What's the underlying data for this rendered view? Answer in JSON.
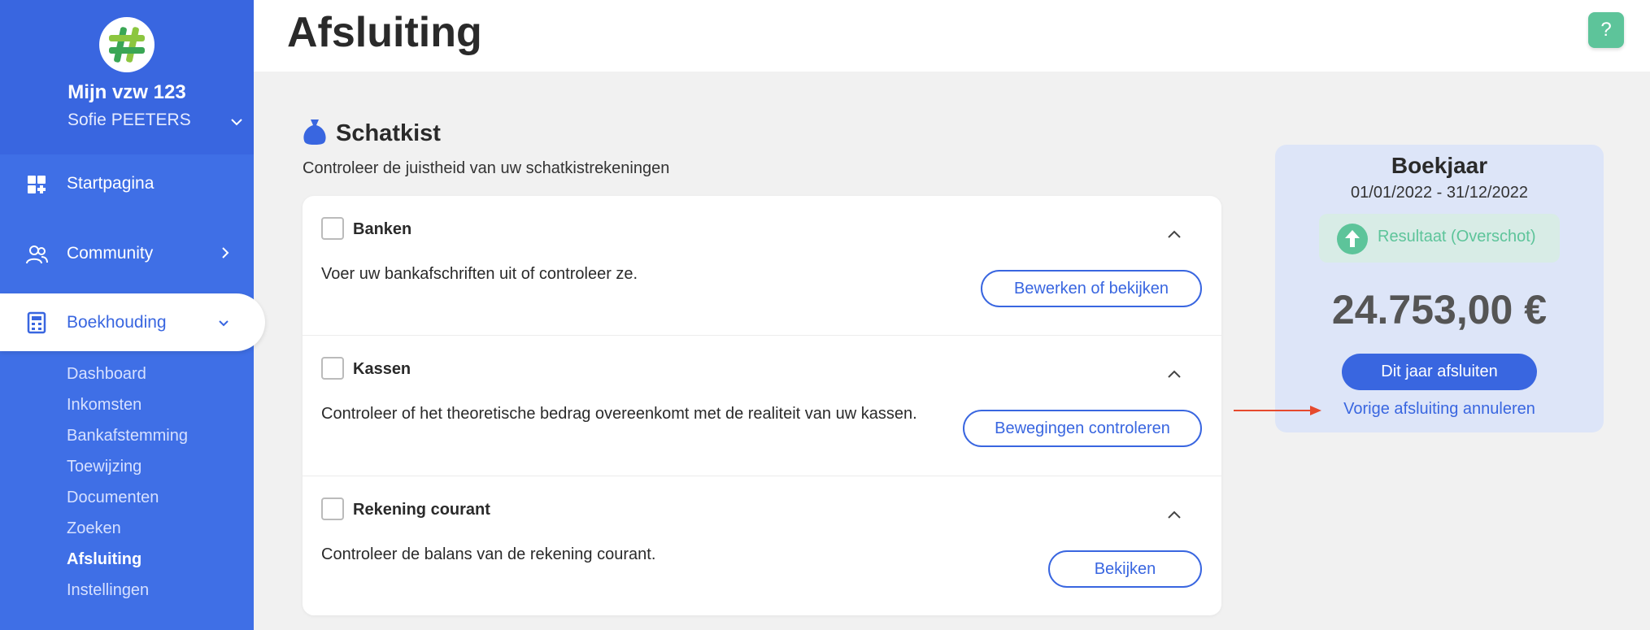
{
  "sidebar": {
    "org_name": "Mijn vzw 123",
    "user_name": "Sofie PEETERS",
    "nav": {
      "home": "Startpagina",
      "community": "Community",
      "accounting": "Boekhouding"
    },
    "subnav": [
      "Dashboard",
      "Inkomsten",
      "Bankafstemming",
      "Toewijzing",
      "Documenten",
      "Zoeken",
      "Afsluiting",
      "Instellingen"
    ],
    "current_subnav": "Afsluiting"
  },
  "header": {
    "title": "Afsluiting",
    "help_label": "?"
  },
  "section": {
    "title": "Schatkist",
    "subtitle": "Controleer de juistheid van uw schatkistrekeningen"
  },
  "rows": [
    {
      "title": "Banken",
      "description": "Voer uw bankafschriften uit of controleer ze.",
      "button": "Bewerken of bekijken"
    },
    {
      "title": "Kassen",
      "description": "Controleer of het theoretische bedrag overeenkomt met de realiteit van uw kassen.",
      "button": "Bewegingen controleren"
    },
    {
      "title": "Rekening courant",
      "description": "Controleer de balans van de rekening courant.",
      "button": "Bekijken"
    }
  ],
  "fiscal_year": {
    "title": "Boekjaar",
    "period": "01/01/2022 - 31/12/2022",
    "result_label": "Resultaat (Overschot)",
    "amount": "24.753,00 €",
    "close_button": "Dit jaar afsluiten",
    "cancel_link": "Vorige afsluiting annuleren"
  },
  "colors": {
    "sidebar": "#3f6fe6",
    "accent": "#3966e0",
    "success": "#5dc49a",
    "annotation_arrow": "#e64a2e"
  }
}
